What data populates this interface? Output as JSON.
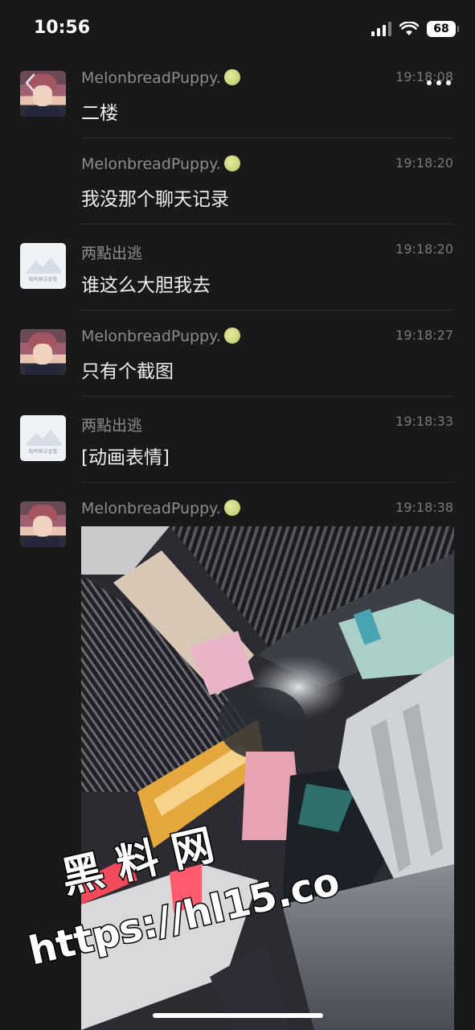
{
  "status_bar": {
    "time": "10:56",
    "battery": "68"
  },
  "messages": [
    {
      "sender": "MelonbreadPuppy.",
      "time": "19:18:08",
      "text": "二楼",
      "avatar": "person"
    },
    {
      "sender": "MelonbreadPuppy.",
      "time": "19:18:20",
      "text": "我没那个聊天记录",
      "avatar": "none"
    },
    {
      "sender": "两點出逃",
      "time": "19:18:20",
      "text": "谁这么大胆我去",
      "avatar": "default"
    },
    {
      "sender": "MelonbreadPuppy.",
      "time": "19:18:27",
      "text": "只有个截图",
      "avatar": "person"
    },
    {
      "sender": "两點出逃",
      "time": "19:18:33",
      "text": "[动画表情]",
      "avatar": "default"
    },
    {
      "sender": "MelonbreadPuppy.",
      "time": "19:18:38",
      "avatar": "person"
    }
  ],
  "default_avatar_caption": "臨時無法查看",
  "watermark": {
    "line1": "黑 料 网",
    "line2": "https://hl15.co"
  },
  "icons": [
    "back-arrow-icon",
    "more-icon",
    "wifi-icon",
    "signal-icon",
    "battery-icon",
    "melon-emoji-icon",
    "mountain-placeholder-icon"
  ]
}
